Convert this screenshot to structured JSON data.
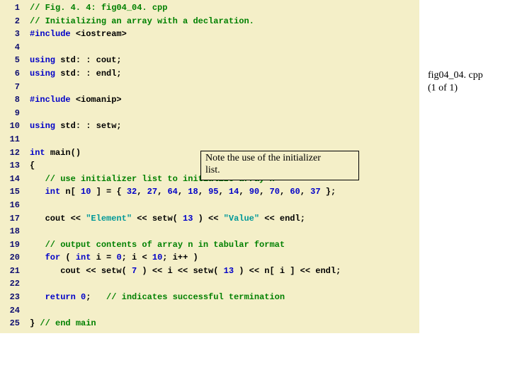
{
  "caption": {
    "line1": "fig04_04. cpp",
    "line2": "(1 of 1)"
  },
  "callout": {
    "line1": "Note the use of the initializer",
    "line2": "list."
  },
  "lines": {
    "l1": {
      "n": "1",
      "c": "// Fig. 4. 4: fig04_04. cpp"
    },
    "l2": {
      "n": "2",
      "c": "// Initializing an array with a declaration."
    },
    "l3": {
      "n": "3",
      "a": "#include ",
      "b": "<iostream>"
    },
    "l4": {
      "n": "4"
    },
    "l5": {
      "n": "5",
      "a": "using ",
      "b": "std: : cout;"
    },
    "l6": {
      "n": "6",
      "a": "using ",
      "b": "std: : endl;"
    },
    "l7": {
      "n": "7"
    },
    "l8": {
      "n": "8",
      "a": "#include ",
      "b": "<iomanip>"
    },
    "l9": {
      "n": "9"
    },
    "l10": {
      "n": "10",
      "a": "using ",
      "b": "std: : setw;"
    },
    "l11": {
      "n": "11"
    },
    "l12": {
      "n": "12",
      "a": "int ",
      "b": "main()"
    },
    "l13": {
      "n": "13",
      "a": "{"
    },
    "l14": {
      "n": "14",
      "c": "   // use initializer list to initialize array n"
    },
    "l15": {
      "n": "15",
      "a": "   int ",
      "b": "n[ ",
      "c": "10",
      "d": " ] = { ",
      "e": "32",
      "f": ", ",
      "g": "27",
      "h": ", ",
      "i": "64",
      "j": ", ",
      "k": "18",
      "l": ", ",
      "m": "95",
      "nn": ", ",
      "o": "14",
      "p": ", ",
      "q": "90",
      "r": ", ",
      "s": "70",
      "t": ", ",
      "u": "60",
      "v": ", ",
      "w": "37",
      "x": " };"
    },
    "l16": {
      "n": "16"
    },
    "l17": {
      "n": "17",
      "a": "   cout << ",
      "b": "\"Element\"",
      "c": " << setw( ",
      "d": "13",
      "e": " ) << ",
      "f": "\"Value\"",
      "g": " << endl;"
    },
    "l18": {
      "n": "18"
    },
    "l19": {
      "n": "19",
      "c": "   // output contents of array n in tabular format"
    },
    "l20": {
      "n": "20",
      "a": "   for ",
      "b": "( ",
      "c": "int ",
      "d": "i = ",
      "e": "0",
      "f": "; i < ",
      "g": "10",
      "h": "; i++ )"
    },
    "l21": {
      "n": "21",
      "a": "      cout << setw( ",
      "b": "7",
      "c": " ) << i << setw( ",
      "d": "13",
      "e": " ) << n[ i ] << endl;"
    },
    "l22": {
      "n": "22"
    },
    "l23": {
      "n": "23",
      "a": "   return ",
      "b": "0",
      "c": ";   ",
      "d": "// indicates successful termination"
    },
    "l24": {
      "n": "24"
    },
    "l25": {
      "n": "25",
      "a": "} ",
      "b": "// end main"
    }
  }
}
